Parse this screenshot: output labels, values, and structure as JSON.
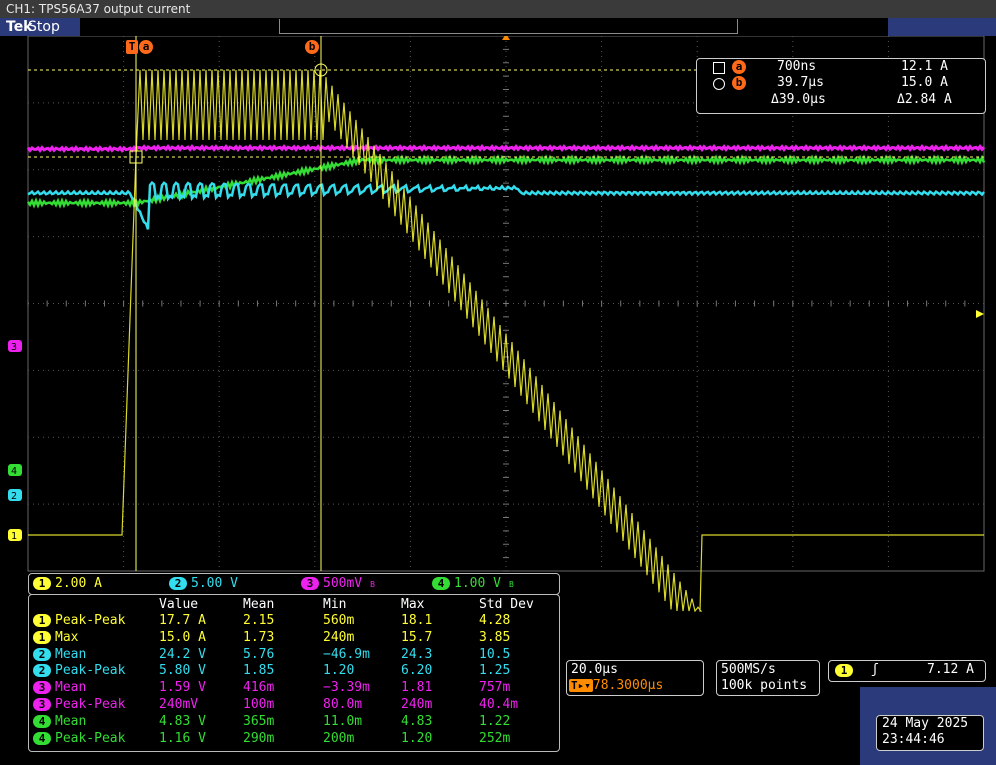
{
  "window": {
    "title": "CH1: TPS56A37 output current"
  },
  "status": {
    "brand": "Tek",
    "state": "Stop"
  },
  "cursors": {
    "a_label": "a",
    "b_label": "b",
    "trigger_label": "T",
    "a_time": "700ns",
    "a_value": "12.1 A",
    "b_time": "39.7µs",
    "b_value": "15.0 A",
    "delta_time": "Δ39.0µs",
    "delta_value": "Δ2.84 A"
  },
  "channels": [
    {
      "num": "1",
      "scale": "2.00 A",
      "color": "#ffff33"
    },
    {
      "num": "2",
      "scale": "5.00 V",
      "color": "#33ddee"
    },
    {
      "num": "3",
      "scale": "500mV",
      "color": "#ee22ee",
      "bw": "B"
    },
    {
      "num": "4",
      "scale": "1.00 V",
      "color": "#33dd33",
      "bw": "B"
    }
  ],
  "measurements": {
    "headers": [
      "Value",
      "Mean",
      "Min",
      "Max",
      "Std Dev"
    ],
    "rows": [
      {
        "ch": "1",
        "name": "Peak-Peak",
        "value": "17.7 A",
        "mean": "2.15",
        "min": "560m",
        "max": "18.1",
        "std": "4.28",
        "color": "#ffff33"
      },
      {
        "ch": "1",
        "name": "Max",
        "value": "15.0 A",
        "mean": "1.73",
        "min": "240m",
        "max": "15.7",
        "std": "3.85",
        "color": "#ffff33"
      },
      {
        "ch": "2",
        "name": "Mean",
        "value": "24.2 V",
        "mean": "5.76",
        "min": "−46.9m",
        "max": "24.3",
        "std": "10.5",
        "color": "#33ddee"
      },
      {
        "ch": "2",
        "name": "Peak-Peak",
        "value": "5.80 V",
        "mean": "1.85",
        "min": "1.20",
        "max": "6.20",
        "std": "1.25",
        "color": "#33ddee"
      },
      {
        "ch": "3",
        "name": "Mean",
        "value": "1.59 V",
        "mean": "416m",
        "min": "−3.39m",
        "max": "1.81",
        "std": "757m",
        "color": "#ee22ee"
      },
      {
        "ch": "3",
        "name": "Peak-Peak",
        "value": "240mV",
        "mean": "100m",
        "min": "80.0m",
        "max": "240m",
        "std": "40.4m",
        "color": "#ee22ee"
      },
      {
        "ch": "4",
        "name": "Mean",
        "value": "4.83 V",
        "mean": "365m",
        "min": "11.0m",
        "max": "4.83",
        "std": "1.22",
        "color": "#33dd33"
      },
      {
        "ch": "4",
        "name": "Peak-Peak",
        "value": "1.16 V",
        "mean": "290m",
        "min": "200m",
        "max": "1.20",
        "std": "252m",
        "color": "#33dd33"
      }
    ]
  },
  "horizontal": {
    "scale": "20.0µs",
    "position": "78.3000µs",
    "sample_rate": "500MS/s",
    "record": "100k points"
  },
  "trigger": {
    "channel": "1",
    "slope": "rising",
    "level": "7.12 A"
  },
  "datetime": {
    "date": "24 May 2025",
    "time": "23:44:46"
  },
  "colors": {
    "ch1": "#ffff33",
    "ch2": "#33ddee",
    "ch3": "#ee22ee",
    "ch4": "#33dd33",
    "cursor": "#ff6a1a",
    "panel": "#2b3a7a"
  }
}
